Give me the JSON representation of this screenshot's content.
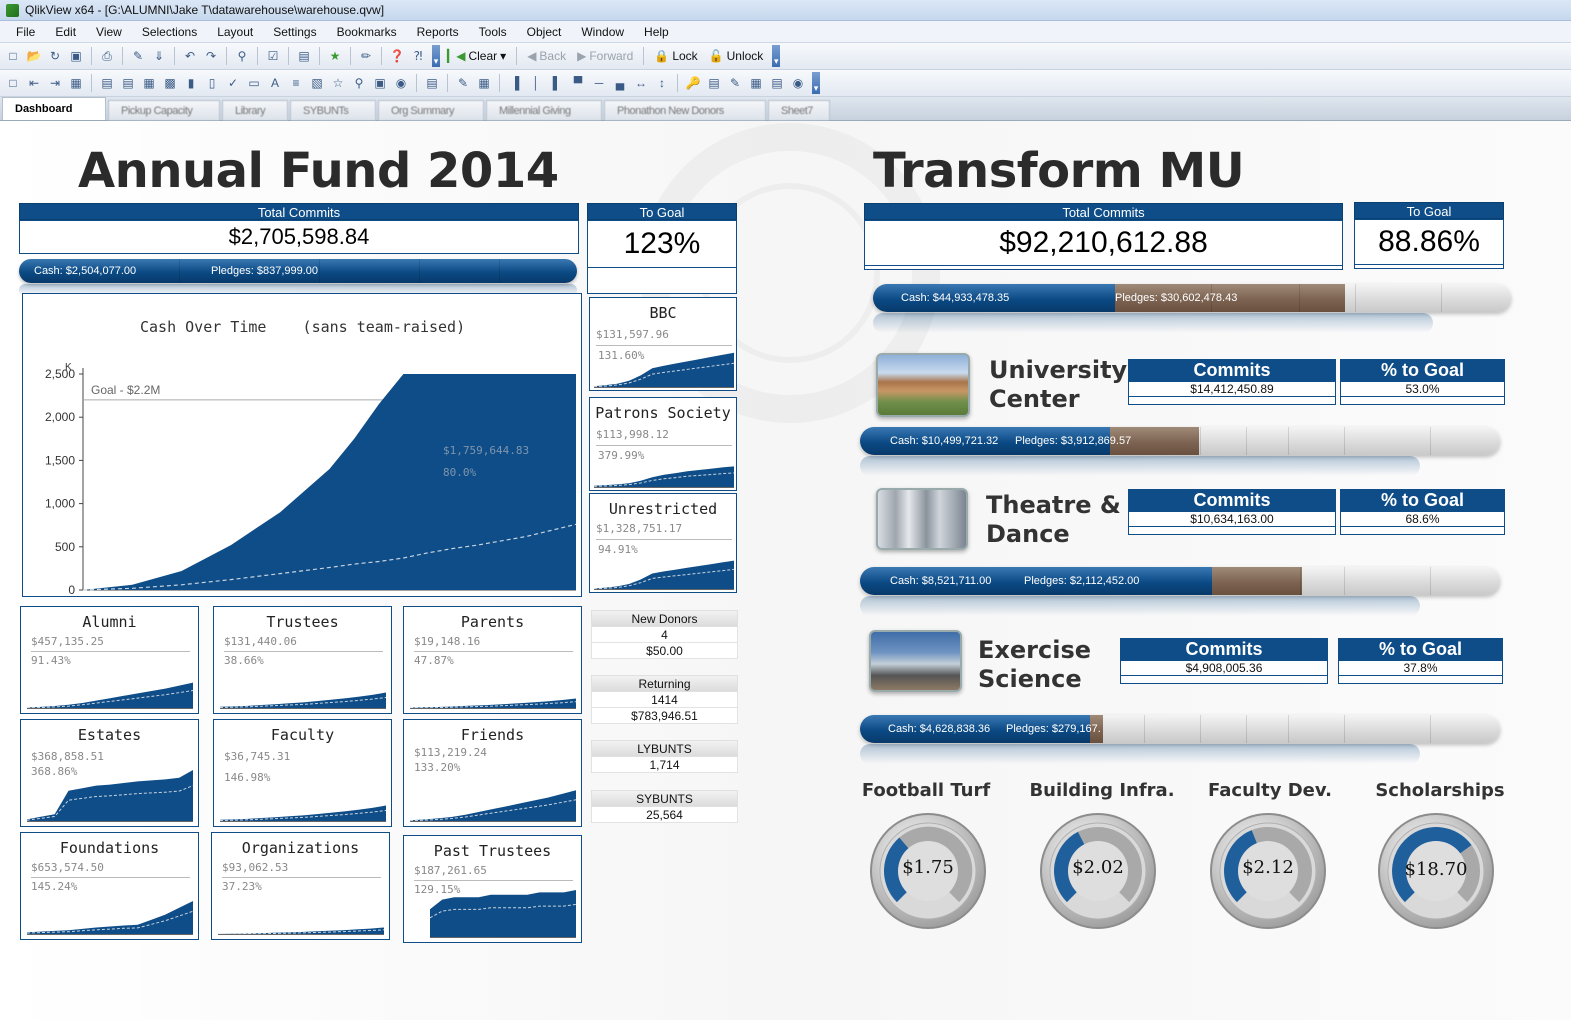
{
  "window": {
    "title": "QlikView x64 - [G:\\ALUMNI\\Jake T\\datawarehouse\\warehouse.qvw]"
  },
  "menu": [
    "File",
    "Edit",
    "View",
    "Selections",
    "Layout",
    "Settings",
    "Bookmarks",
    "Reports",
    "Tools",
    "Object",
    "Window",
    "Help"
  ],
  "toolbar": {
    "clear": "Clear",
    "back": "Back",
    "forward": "Forward",
    "lock": "Lock",
    "unlock": "Unlock"
  },
  "tabs": [
    "Dashboard",
    "Pickup Capacity",
    "Library",
    "SYBUNTs",
    "Org Summary",
    "Millennial Giving",
    "Phonathon New Donors",
    "Sheet7"
  ],
  "annual": {
    "title": "Annual Fund 2014",
    "total_label": "Total Commits",
    "total_value": "$2,705,598.84",
    "goal_label": "To Goal",
    "goal_value": "123%",
    "cash": "Cash: $2,504,077.00",
    "pledges": "Pledges: $837,999.00"
  },
  "chart": {
    "title": "Cash Over Time    (sans team-raised)",
    "unit": "K",
    "goal_label": "Goal - $2.2M",
    "annot_value": "$1,759,644.83",
    "annot_pct": "80.0%",
    "yticks": [
      "2,500",
      "2,000",
      "1,500",
      "1,000",
      "500",
      "0"
    ]
  },
  "chart_data": {
    "type": "area",
    "title": "Cash Over Time    (sans team-raised)",
    "ylabel": "K",
    "ylim": [
      0,
      2500
    ],
    "goal": 2200,
    "x": [
      0,
      10,
      20,
      30,
      40,
      50,
      55,
      60,
      65,
      70,
      75,
      80,
      90,
      100
    ],
    "series": [
      {
        "values": [
          0,
          60,
          220,
          520,
          900,
          1400,
          1750,
          2150,
          2500,
          2500,
          2500,
          2500,
          2500,
          2500
        ]
      },
      {
        "values": [
          0,
          20,
          60,
          120,
          190,
          260,
          300,
          330,
          370,
          430,
          480,
          520,
          620,
          760
        ]
      }
    ]
  },
  "side": {
    "bbc": {
      "title": "BBC",
      "amount": "$131,597.96",
      "pct": "131.60%"
    },
    "patrons": {
      "title": "Patrons Society",
      "amount": "$113,998.12",
      "pct": "379.99%"
    },
    "unrestricted": {
      "title": "Unrestricted",
      "amount": "$1,328,751.17",
      "pct": "94.91%"
    }
  },
  "groups": [
    {
      "title": "Alumni",
      "amount": "$457,135.25",
      "pct": "91.43%"
    },
    {
      "title": "Trustees",
      "amount": "$131,440.06",
      "pct": "38.66%"
    },
    {
      "title": "Parents",
      "amount": "$19,148.16",
      "pct": "47.87%"
    },
    {
      "title": "Estates",
      "amount": "$368,858.51",
      "pct": "368.86%"
    },
    {
      "title": "Faculty",
      "amount": "$36,745.31",
      "pct": "146.98%"
    },
    {
      "title": "Friends",
      "amount": "$113,219.24",
      "pct": "133.20%"
    },
    {
      "title": "Foundations",
      "amount": "$653,574.50",
      "pct": "145.24%"
    },
    {
      "title": "Organizations",
      "amount": "$93,062.53",
      "pct": "37.23%"
    },
    {
      "title": "Past Trustees",
      "amount": "$187,261.65",
      "pct": "129.15%"
    }
  ],
  "stats": {
    "new_donors": {
      "label": "New Donors",
      "count": "4",
      "amount": "$50.00"
    },
    "returning": {
      "label": "Returning",
      "count": "1414",
      "amount": "$783,946.51"
    },
    "lybunts": {
      "label": "LYBUNTS",
      "count": "1,714"
    },
    "sybunts": {
      "label": "SYBUNTS",
      "count": "25,564"
    }
  },
  "transform": {
    "title": "Transform MU",
    "total_label": "Total Commits",
    "total_value": "$92,210,612.88",
    "goal_label": "To Goal",
    "goal_value": "88.86%",
    "cash": "Cash: $44,933,478.35",
    "pledges": "Pledges: $30,602,478.43",
    "cash_frac": 0.38,
    "pledge_frac": 0.36
  },
  "projects": [
    {
      "title1": "University",
      "title2": "Center",
      "commits_label": "Commits",
      "commits": "$14,412,450.89",
      "goal_label": "% to Goal",
      "goal": "53.0%",
      "cash": "Cash: $10,499,721.32",
      "pledges": "Pledges: $3,912,869.57",
      "cash_frac": 0.39,
      "pledge_frac": 0.14
    },
    {
      "title1": "Theatre &",
      "title2": "Dance",
      "commits_label": "Commits",
      "commits": "$10,634,163.00",
      "goal_label": "% to Goal",
      "goal": "68.6%",
      "cash": "Cash: $8,521,711.00",
      "pledges": "Pledges: $2,112,452.00",
      "cash_frac": 0.55,
      "pledge_frac": 0.14
    },
    {
      "title1": "Exercise",
      "title2": "Science",
      "commits_label": "Commits",
      "commits": "$4,908,005.36",
      "goal_label": "% to Goal",
      "goal": "37.8%",
      "cash": "Cash: $4,628,838.36",
      "pledges": "Pledges: $279,167.",
      "cash_frac": 0.36,
      "pledge_frac": 0.02
    }
  ],
  "gauges": [
    {
      "label": "Football Turf",
      "value": "$1.75",
      "frac": 0.35
    },
    {
      "label": "Building Infra.",
      "value": "$2.02",
      "frac": 0.4
    },
    {
      "label": "Faculty Dev.",
      "value": "$2.12",
      "frac": 0.42
    },
    {
      "label": "Scholarships",
      "value": "$18.70",
      "frac": 0.7
    }
  ],
  "colors": {
    "navy": "#0e4d88",
    "pledge": "#7d6452",
    "accent": "#3c9a34"
  }
}
